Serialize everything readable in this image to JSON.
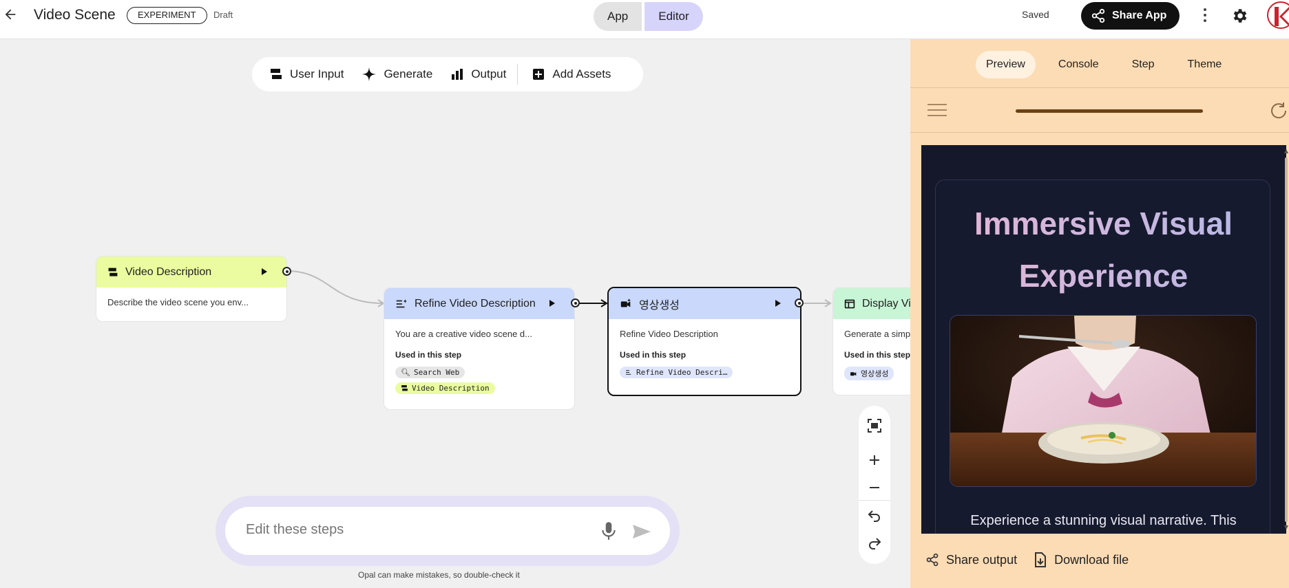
{
  "header": {
    "title": "Video Scene",
    "experiment_badge": "EXPERIMENT",
    "status": "Draft",
    "mode_tabs": [
      "App",
      "Editor"
    ],
    "save_status": "Saved",
    "share_label": "Share App"
  },
  "toolbar": {
    "items": [
      "User Input",
      "Generate",
      "Output",
      "Add Assets"
    ]
  },
  "nodes": [
    {
      "title": "Video Description",
      "body": "Describe the video scene you env...",
      "color": "#eafc9f"
    },
    {
      "title": "Refine Video Description",
      "body": "You are a creative video scene d...",
      "used_label": "Used in this step",
      "tags": [
        "Search Web",
        "Video Description"
      ],
      "color": "#c9d8fb"
    },
    {
      "title": "영상생성",
      "body": "Refine Video Description",
      "used_label": "Used in this step",
      "tags": [
        "Refine Video Descri…"
      ],
      "color": "#c9d8fb"
    },
    {
      "title": "Display Vid",
      "body": "Generate a simp",
      "used_label": "Used in this step",
      "tags": [
        "영상생성"
      ],
      "color": "#c8f5d6"
    }
  ],
  "prompt": {
    "placeholder": "Edit these steps",
    "disclaimer": "Opal can make mistakes, so double-check it"
  },
  "panel": {
    "tabs": [
      "Preview",
      "Console",
      "Step",
      "Theme"
    ],
    "active_tab": "Preview",
    "preview": {
      "title": "Immersive Visual Experience",
      "description": "Experience a stunning visual narrative. This"
    },
    "footer": [
      "Share output",
      "Download file"
    ]
  },
  "colors": {
    "accent": "#d7d4fb",
    "panel_bg": "#fcdcb5",
    "preview_bg": "#15182b"
  }
}
